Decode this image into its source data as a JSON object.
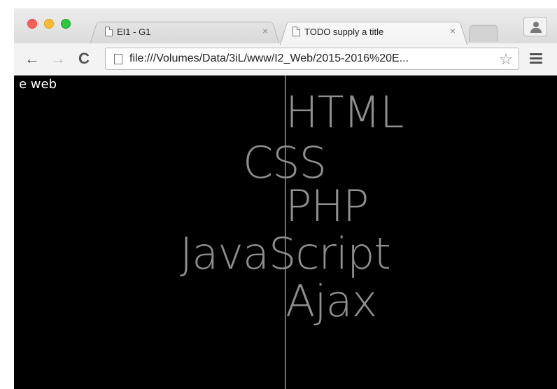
{
  "tabs": [
    {
      "title": "EI1 - G1",
      "active": false
    },
    {
      "title": "TODO supply a title",
      "active": true
    }
  ],
  "toolbar": {
    "url": "file:///Volumes/Data/3iL/www/I2_Web/2015-2016%20E..."
  },
  "page": {
    "corner_text": "e web",
    "words": [
      "HTML",
      "CSS",
      "PHP",
      "JavaScript",
      "Ajax"
    ]
  },
  "icons": {
    "close_tab": "×",
    "back": "←",
    "forward": "→",
    "reload": "C",
    "star": "☆"
  },
  "colors": {
    "page_background": "#000000",
    "word_color": "#8f8f8f",
    "centerline_color": "#dcdcdc"
  }
}
